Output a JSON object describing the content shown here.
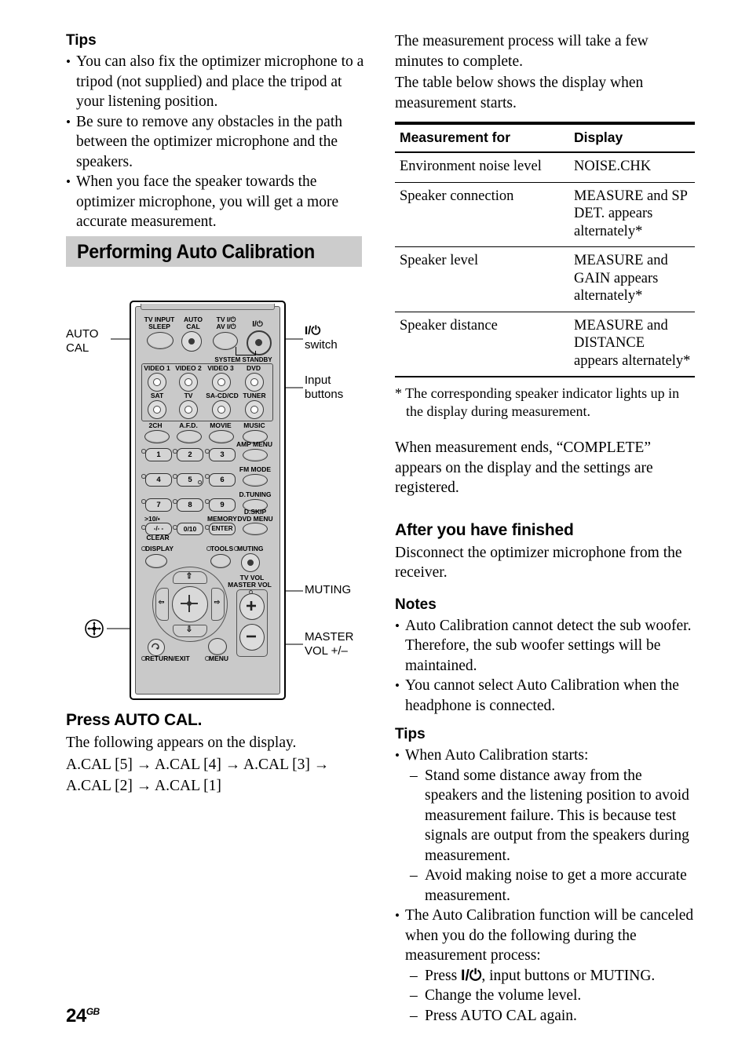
{
  "page": {
    "number": "24",
    "suffix": "GB"
  },
  "left_column": {
    "tips_heading": "Tips",
    "tips": [
      "You can also fix the optimizer microphone to a tripod (not supplied) and place the tripod at your listening position.",
      "Be sure to remove any obstacles in the path between the optimizer microphone and the speakers.",
      "When you face the speaker towards the optimizer microphone, you will get a more accurate measurement."
    ],
    "section_heading": "Performing Auto Calibration",
    "step_heading": "Press AUTO CAL.",
    "step_body_1": "The following appears on the display.",
    "step_body_2": "A.CAL [5] → A.CAL [4] → A.CAL [3] →",
    "step_body_3": "A.CAL [2] → A.CAL [1]"
  },
  "figure": {
    "callouts": {
      "auto_cal": "AUTO\nCAL",
      "power_switch": "I/⏻\nswitch",
      "input_buttons": "Input\nbuttons",
      "muting": "MUTING",
      "master_vol": "MASTER\nVOL +/–",
      "joystick": "joystick-icon"
    },
    "remote": {
      "top_row": [
        {
          "label": "TV INPUT\nSLEEP"
        },
        {
          "label": "AUTO\nCAL"
        },
        {
          "label": "TV I/⏻\nAV I/⏻"
        },
        {
          "label": "I/⏻"
        }
      ],
      "system_standby": "SYSTEM STANDBY",
      "input_row_1": [
        "VIDEO 1",
        "VIDEO 2",
        "VIDEO 3",
        "DVD"
      ],
      "input_row_2": [
        "SAT",
        "TV",
        "SA-CD/CD",
        "TUNER"
      ],
      "mode_row": [
        "2CH",
        "A.F.D.",
        "MOVIE",
        "MUSIC"
      ],
      "num_row_1": [
        "1",
        "2",
        "3"
      ],
      "num_row_1_side": "AMP MENU",
      "num_row_2": [
        "4",
        "5",
        "6"
      ],
      "num_row_2_side": "FM MODE",
      "num_row_3": [
        "7",
        "8",
        "9"
      ],
      "num_row_3_side": "D.TUNING",
      "num_row_4": [
        ">10/▪\n-/--",
        "0/10",
        "ENTER"
      ],
      "clear_label": "CLEAR",
      "memory_label": "MEMORY",
      "dskip_label": "D.SKIP",
      "dvdmenu_label": "DVD MENU",
      "display_label": "DISPLAY",
      "tools_label": "TOOLS",
      "muting_label": "MUTING",
      "tvvol_label": "TV VOL",
      "mastervol_label": "MASTER VOL",
      "return_label": "RETURN/EXIT",
      "menu_label": "MENU",
      "vol_plus": "+",
      "vol_minus": "−"
    }
  },
  "right_column": {
    "intro_1": "The measurement process will take a few minutes to complete.",
    "intro_2": "The table below shows the display when measurement starts.",
    "table": {
      "headers": [
        "Measurement for",
        "Display"
      ],
      "rows": [
        [
          "Environment noise level",
          "NOISE.CHK"
        ],
        [
          "Speaker connection",
          "MEASURE and SP DET. appears alternately*"
        ],
        [
          "Speaker level",
          "MEASURE and GAIN appears alternately*"
        ],
        [
          "Speaker distance",
          "MEASURE and DISTANCE appears alternately*"
        ]
      ]
    },
    "footnote": "* The corresponding speaker indicator lights up in the display during measurement.",
    "after_measurement": "When measurement ends, “COMPLETE” appears on the display and the settings are registered.",
    "finished_heading": "After you have finished",
    "finished_body": "Disconnect the optimizer microphone from the receiver.",
    "notes_heading": "Notes",
    "notes": [
      "Auto Calibration cannot detect the sub woofer. Therefore, the sub woofer settings will be maintained.",
      "You cannot select Auto Calibration when the headphone is connected."
    ],
    "tips_heading": "Tips",
    "tip_1": "When Auto Calibration starts:",
    "tip_1_subs": [
      "Stand some distance away from the speakers and the listening position to avoid measurement failure. This is because test signals are output from the speakers during measurement.",
      "Avoid making noise to get a more accurate measurement."
    ],
    "tip_2": "The Auto Calibration function will be canceled when you do the following during the measurement process:",
    "tip_2_subs_pre": "Press ",
    "tip_2_subs": [
      ", input buttons or MUTING.",
      "Change the volume level.",
      "Press AUTO CAL again."
    ],
    "tip_2_sub_2": "Change the volume level.",
    "tip_2_sub_3": "Press AUTO CAL again."
  }
}
